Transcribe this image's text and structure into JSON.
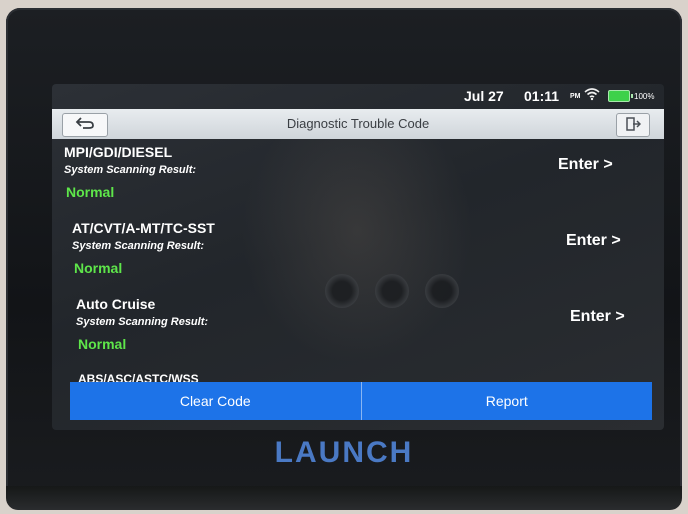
{
  "status_bar": {
    "date": "Jul 27",
    "time": "01:11",
    "ampm": "PM",
    "wifi_icon": "wifi-icon",
    "battery_icon": "battery-icon",
    "battery_percent": "100%",
    "battery_color": "#3ed14a"
  },
  "header": {
    "title": "Diagnostic Trouble Code",
    "back_icon": "back-arrow-icon",
    "exit_icon": "exit-icon"
  },
  "systems": [
    {
      "name": "MPI/GDI/DIESEL",
      "result_label": "System Scanning Result:",
      "result": "Normal",
      "enter_label": "Enter >"
    },
    {
      "name": "AT/CVT/A-MT/TC-SST",
      "result_label": "System Scanning Result:",
      "result": "Normal",
      "enter_label": "Enter >"
    },
    {
      "name": "Auto Cruise",
      "result_label": "System Scanning Result:",
      "result": "Normal",
      "enter_label": "Enter >"
    }
  ],
  "partial_item": "ABS/ASC/ASTC/WSS",
  "footer": {
    "clear_code_label": "Clear Code",
    "report_label": "Report",
    "button_color": "#1d73e8"
  },
  "brand": "LAUNCH",
  "colors": {
    "normal_status": "#5ee64a",
    "brand": "#4a79c4"
  }
}
